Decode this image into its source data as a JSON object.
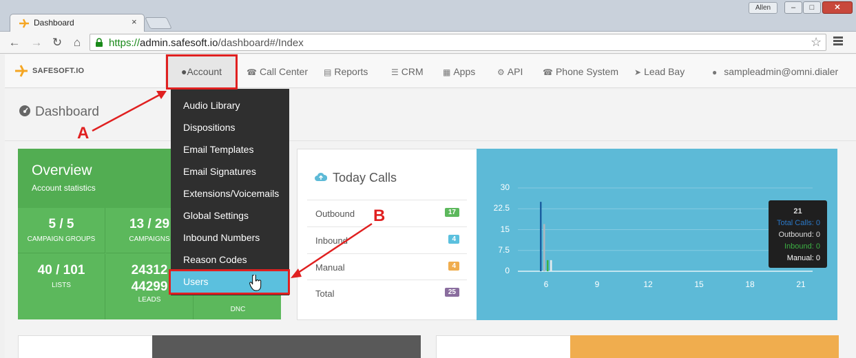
{
  "browser": {
    "tab_title": "Dashboard",
    "tab_close": "×",
    "os_user": "Allen",
    "window_buttons": {
      "minimize": "–",
      "maximize": "□",
      "close": "✕"
    },
    "url_scheme": "https://",
    "url_host": "admin.safesoft.io",
    "url_path": "/dashboard#/Index",
    "nav_glyphs": {
      "back": "←",
      "forward": "→",
      "reload": "↻",
      "home": "⌂",
      "star": "☆"
    },
    "accent_url_color": "#1a8a1a"
  },
  "navbar": {
    "brand": "SAFESOFT.IO",
    "items": [
      {
        "label": "Account",
        "icon": "user-icon"
      },
      {
        "label": "Call Center",
        "icon": "phone-icon"
      },
      {
        "label": "Reports",
        "icon": "bar-chart-icon"
      },
      {
        "label": "CRM",
        "icon": "list-icon"
      },
      {
        "label": "Apps",
        "icon": "grid-icon"
      },
      {
        "label": "API",
        "icon": "cog-icon"
      },
      {
        "label": "Phone System",
        "icon": "phone-icon"
      },
      {
        "label": "Lead Bay",
        "icon": "send-icon"
      }
    ],
    "user": "sampleadmin@omni.dialer"
  },
  "dropdown": {
    "items": [
      "Audio Library",
      "Dispositions",
      "Email Templates",
      "Email Signatures",
      "Extensions/Voicemails",
      "Global Settings",
      "Inbound Numbers",
      "Reason Codes",
      "Users"
    ],
    "active": "Users"
  },
  "page": {
    "title": "Dashboard"
  },
  "overview": {
    "title": "Overview",
    "subtitle": "Account statistics",
    "stats": [
      {
        "value": "5 / 5",
        "label": "CAMPAIGN GROUPS"
      },
      {
        "value": "13 / 29",
        "label": "CAMPAIGNS"
      },
      {
        "value": "",
        "label": ""
      },
      {
        "value": "40 / 101",
        "label": "LISTS"
      },
      {
        "value": "24312",
        "value2": "44299",
        "label": "LEADS"
      },
      {
        "value": "",
        "label": "DNC"
      }
    ],
    "color": "#5cb85c"
  },
  "today_calls": {
    "title": "Today Calls",
    "rows": [
      {
        "label": "Outbound",
        "count": "17",
        "color": "#5cb85c"
      },
      {
        "label": "Inbound",
        "count": "4",
        "color": "#5bc0de"
      },
      {
        "label": "Manual",
        "count": "4",
        "color": "#f0ad4e"
      },
      {
        "label": "Total",
        "count": "25",
        "color": "#8a6d9e"
      }
    ]
  },
  "chart_data": {
    "type": "bar",
    "x_ticks": [
      "6",
      "9",
      "12",
      "15",
      "18",
      "21"
    ],
    "y_ticks": [
      "30",
      "22.5",
      "15",
      "7.5",
      "0"
    ],
    "ylim": [
      0,
      30
    ],
    "xlim": [
      5,
      21.5
    ],
    "series": [
      {
        "name": "Total Calls",
        "x": 6,
        "value": 25,
        "color": "#1a5fa0"
      },
      {
        "name": "Outbound",
        "x": 6,
        "value": 17,
        "color": "#b0b8bf"
      },
      {
        "name": "Inbound",
        "x": 6,
        "value": 4,
        "color": "#3cb043"
      },
      {
        "name": "Manual",
        "x": 6,
        "value": 4,
        "color": "#e8ecef"
      }
    ],
    "tooltip": {
      "header": "21",
      "lines": [
        {
          "text": "Total Calls: 0",
          "color": "#2a78c8"
        },
        {
          "text": "Outbound: 0",
          "color": "#dddddd"
        },
        {
          "text": "Inbound: 0",
          "color": "#3cb043"
        },
        {
          "text": "Manual: 0",
          "color": "#ffffff"
        }
      ]
    },
    "background": "#5dbad7"
  },
  "annotations": {
    "label_a": "A",
    "label_b": "B",
    "color": "#e02020"
  }
}
